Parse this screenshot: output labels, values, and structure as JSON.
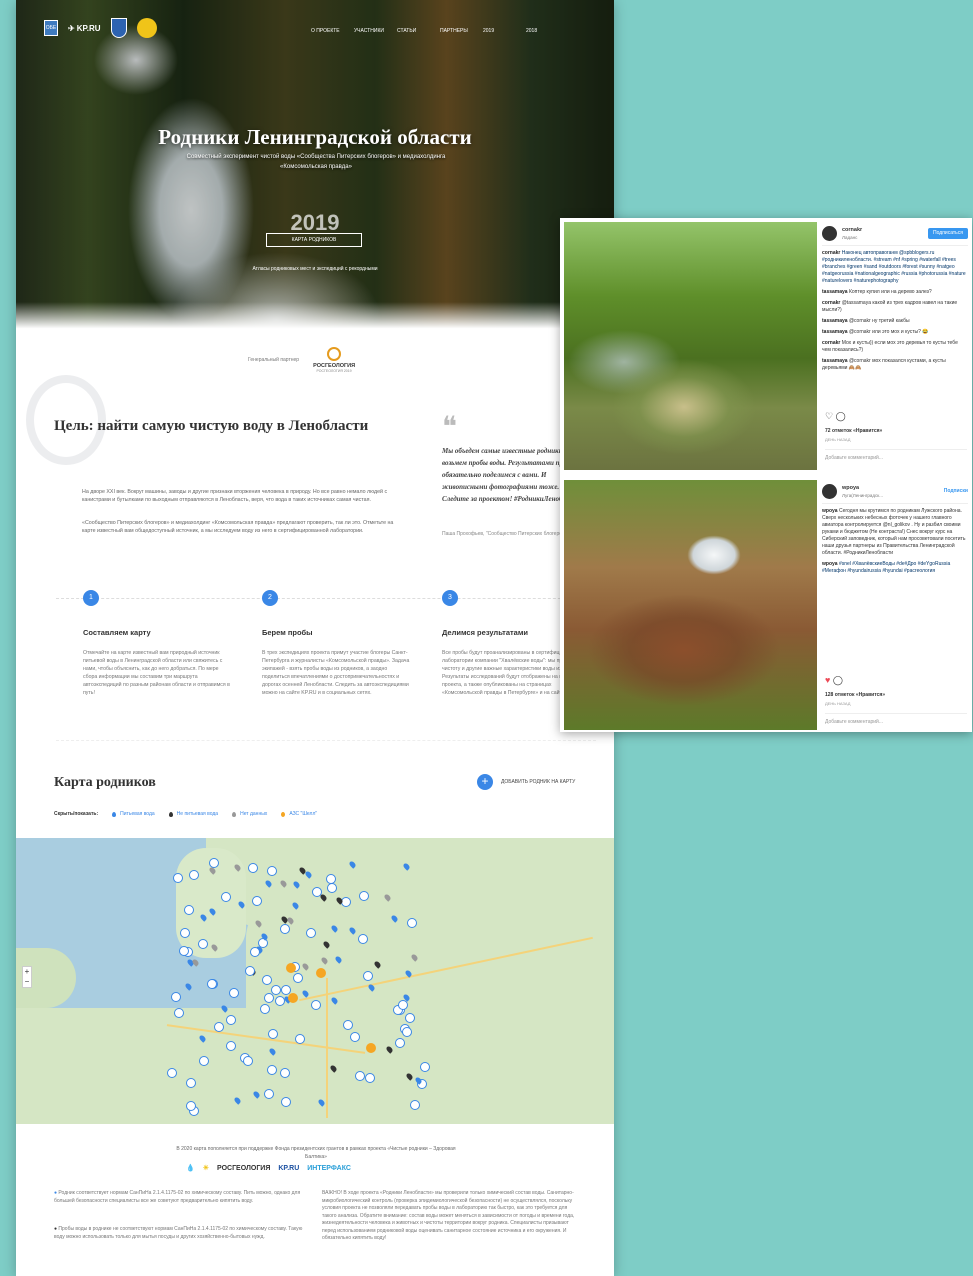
{
  "hero": {
    "logos": [
      "ОБЕ",
      "KP.RU"
    ],
    "nav": [
      "О ПРОЕКТЕ",
      "УЧАСТНИКИ",
      "СТАТЬИ",
      "ПАРТНЕРЫ",
      "2019",
      "2018"
    ],
    "title": "Родники Ленинградской области",
    "subtitle": "Совместный эксперимент чистой воды «Сообщества Питерских блогеров» и медиахолдинга «Комсомольская правда»",
    "year": "2019",
    "button": "КАРТА РОДНИКОВ",
    "link": "Атласы родниковых мест и экспедиций с рекордными"
  },
  "partner": {
    "label": "Генеральный партнер",
    "name": "РОСГЕОЛОГИЯ",
    "sub": "РОСГЕОЛОГИЯ 2019"
  },
  "goal": {
    "title": "Цель: найти самую чистую воду в Ленобласти",
    "p1": "На дворе XXI век. Вокруг машины, заводы и другие признаки вторжения человека в природу. Но все равно немало людей с канистрами и бутылками по выходным отправляются в Ленобласть, веря, что вода в таких источниках самая чистая.",
    "p2": "«Сообщество Питерских блогеров» и медиахолдинг «Комсомольская правда» предлагают проверить, так ли это. Отметьте на карте известный вам общедоступный источник, а мы исследуем воду из него в сертифицированной лаборатории.",
    "quote": "Мы объедем самые известные родники и возьмем пробы воды. Результатами проверки обязательно поделимся с вами. И живописными фотографиями тоже. Следите за проектом! #РодникиЛенобласти.",
    "quote_author": "Паша Прохофьев, \"Сообщество Питерских блогеров\""
  },
  "steps": [
    {
      "num": "1",
      "title": "Составляем карту",
      "text": "Отмечайте на карте известный вам природный источник питьевой воды в Ленинградской области или свяжитесь с нами, чтобы объяснить, как до него добраться. По мере сбора информации мы составим три маршрута автоэкспедиций по разным районам области и отправимся в путь!"
    },
    {
      "num": "2",
      "title": "Берем пробы",
      "text": "В трех экспедициях проекта примут участие блогеры Санкт-Петербурга и журналисты «Комсомольской правды». Задача экипажей - взять пробы воды из родников, а заодно поделиться впечатлениями о достопримечательностях и дорогах осенней Ленобласти. Следить за автоэкспедициями можно на сайте KP.RU и в социальных сетях."
    },
    {
      "num": "3",
      "title": "Делимся результатами",
      "text": "Все пробы будут проанализированы в сертифицированной лаборатории компании \"Хвалёвские воды\": мы проверим чистоту и другие важные характеристики воды из источников. Результаты исследований будут отображены на карте проекта, а также опубликованы на страницах «Комсомольской правды в Петербурге» и на сайте KP.RU."
    }
  ],
  "map": {
    "title": "Карта родников",
    "add_label": "ДОБАВИТЬ РОДНИК НА КАРТУ",
    "filters_label": "Скрыть/показать:",
    "filters": [
      "Питьевая вода",
      "Не питьевая вода",
      "Нет данных",
      "АЗС \"Шелл\""
    ],
    "zoom_in": "+",
    "zoom_out": "−"
  },
  "footer": {
    "text": "В 2020 карта пополняется при поддержке Фонда президентских грантов в рамках проекта «Чистые родники – Здоровая Балтика»",
    "logos": [
      "РОСГЕОЛОГИЯ",
      "KP.RU",
      "ИНТЕРФАКС"
    ],
    "note1": "Родник соответствует нормам СанПиНа 2.1.4.1175-02 по химическому составу. Пить можно, однако для большей безопасности специалисты все же советуют предварительно кипятить воду.",
    "note2": "Пробы воды в роднике не соответствуют нормам СанПиНа 2.1.4.1175-02 по химическому составу. Такую воду можно использовать только для мытья посуды и других хозяйственно-бытовых нужд.",
    "note3": "ВАЖНО! В ходе проекта «Родники Ленобласти» мы проверили только химический состав воды. Санитарно-микробиологический контроль (проверка эпидемиологической безопасности) не осуществлялся, поскольку условия проекта не позволяли передавать пробы воды в лабораторию так быстро, как это требуется для такого анализа. Обратите внимание: состав воды может меняться в зависимости от погоды и времени года, жизнедеятельности человека и животных и чистоты территории вокруг родника. Специалисты призывают перед использованием родниковой воды оценивать санитарное состояние источника и его окружения. И обязательно кипятить воду!"
  },
  "insta": {
    "post1": {
      "user": "cornakr",
      "location": "Ладанс",
      "follow": "Подписаться",
      "comments": [
        {
          "u": "cornakr",
          "t": "Наконец автоправоганм @spbblogers.ru #родникиленобласти. #stream #nf #spring #waterfall #trees #branches #green #sand #outdoors #forest #sunny #natgeo #natgeorussia #nationalgeographic #russia #photorussia #nature #naturelovers #naturephotography"
        },
        {
          "u": "tassamaya",
          "t": "Коптер купил или на дерево залез?"
        },
        {
          "u": "cornakr",
          "t": "@tassamaya какой из трех кадров навел на такие мысли?)"
        },
        {
          "u": "tassamaya",
          "t": "@cornakr ну третий какбы"
        },
        {
          "u": "tassamaya",
          "t": "@cornakr или это мох и кусты? 😂"
        },
        {
          "u": "cornakr",
          "t": "Мох и кусты)) если мох это деревья то кусты тебе чем показались?)"
        },
        {
          "u": "tassamaya",
          "t": "@cornakr мох показался кустами, а кусты деревьями 🙈🙈"
        }
      ],
      "likes": "72 отметок «Нравится»",
      "ago": "ДЕНЬ НАЗАД",
      "add": "Добавьте комментарий..."
    },
    "post2": {
      "user": "wpoya",
      "location": "Луга(Ленинградск...",
      "follow": "Подписки",
      "comments": [
        {
          "u": "wpoya",
          "t": "Сегодня мы крутимся по родникам Лужского района. Сверх нескольких небесных фоточек у нашего главного авиатора контролируется @nl_golikov . Ну и разбил своими руками и бюджетом (Не контраста!) Снес вокруг курс на Сиберский заповедник, который нам просоветовали посетить наши друзья партнеры из Правительства Ленинградской области. #РодникиЛенобласти"
        },
        {
          "u": "wpoya",
          "t": "#snel #ХвалёвскиеВоды #de#Дро #deYgoRussia #Мегафон #hyundairussia #hyundai #расгеология"
        }
      ],
      "likes": "128 отметок «Нравится»",
      "ago": "ДЕНЬ НАЗАД",
      "add": "Добавьте комментарий..."
    }
  },
  "colors": {
    "accent": "#3a87e6",
    "teal_bg": "#7ecdc6",
    "shell": "#f5a623",
    "insta_blue": "#3897f0"
  }
}
